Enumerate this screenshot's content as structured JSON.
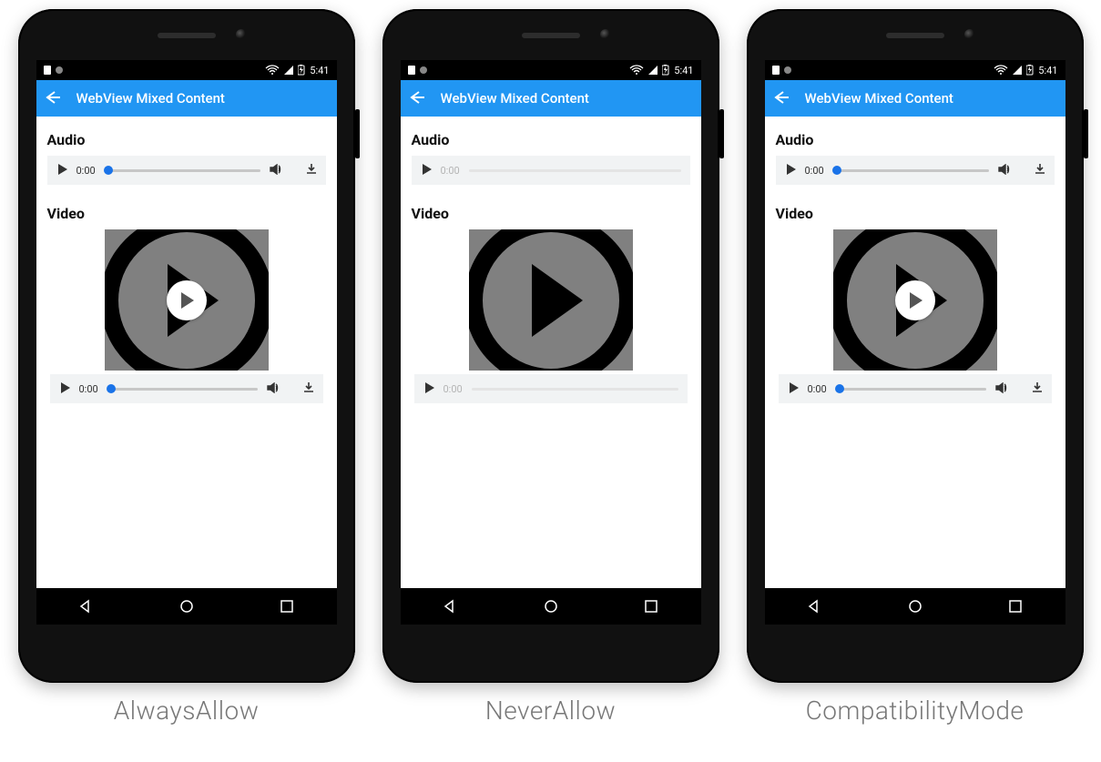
{
  "status": {
    "time": "5:41"
  },
  "appbar": {
    "title": "WebView Mixed Content"
  },
  "sections": {
    "audio": "Audio",
    "video": "Video"
  },
  "media_time_zero": "0:00",
  "phones": [
    {
      "key": "always",
      "caption": "AlwaysAllow",
      "audio_enabled": true,
      "video_enabled": true,
      "overlay_play": true
    },
    {
      "key": "never",
      "caption": "NeverAllow",
      "audio_enabled": false,
      "video_enabled": false,
      "overlay_play": false
    },
    {
      "key": "compat",
      "caption": "CompatibilityMode",
      "audio_enabled": true,
      "video_enabled": true,
      "overlay_play": true
    }
  ]
}
